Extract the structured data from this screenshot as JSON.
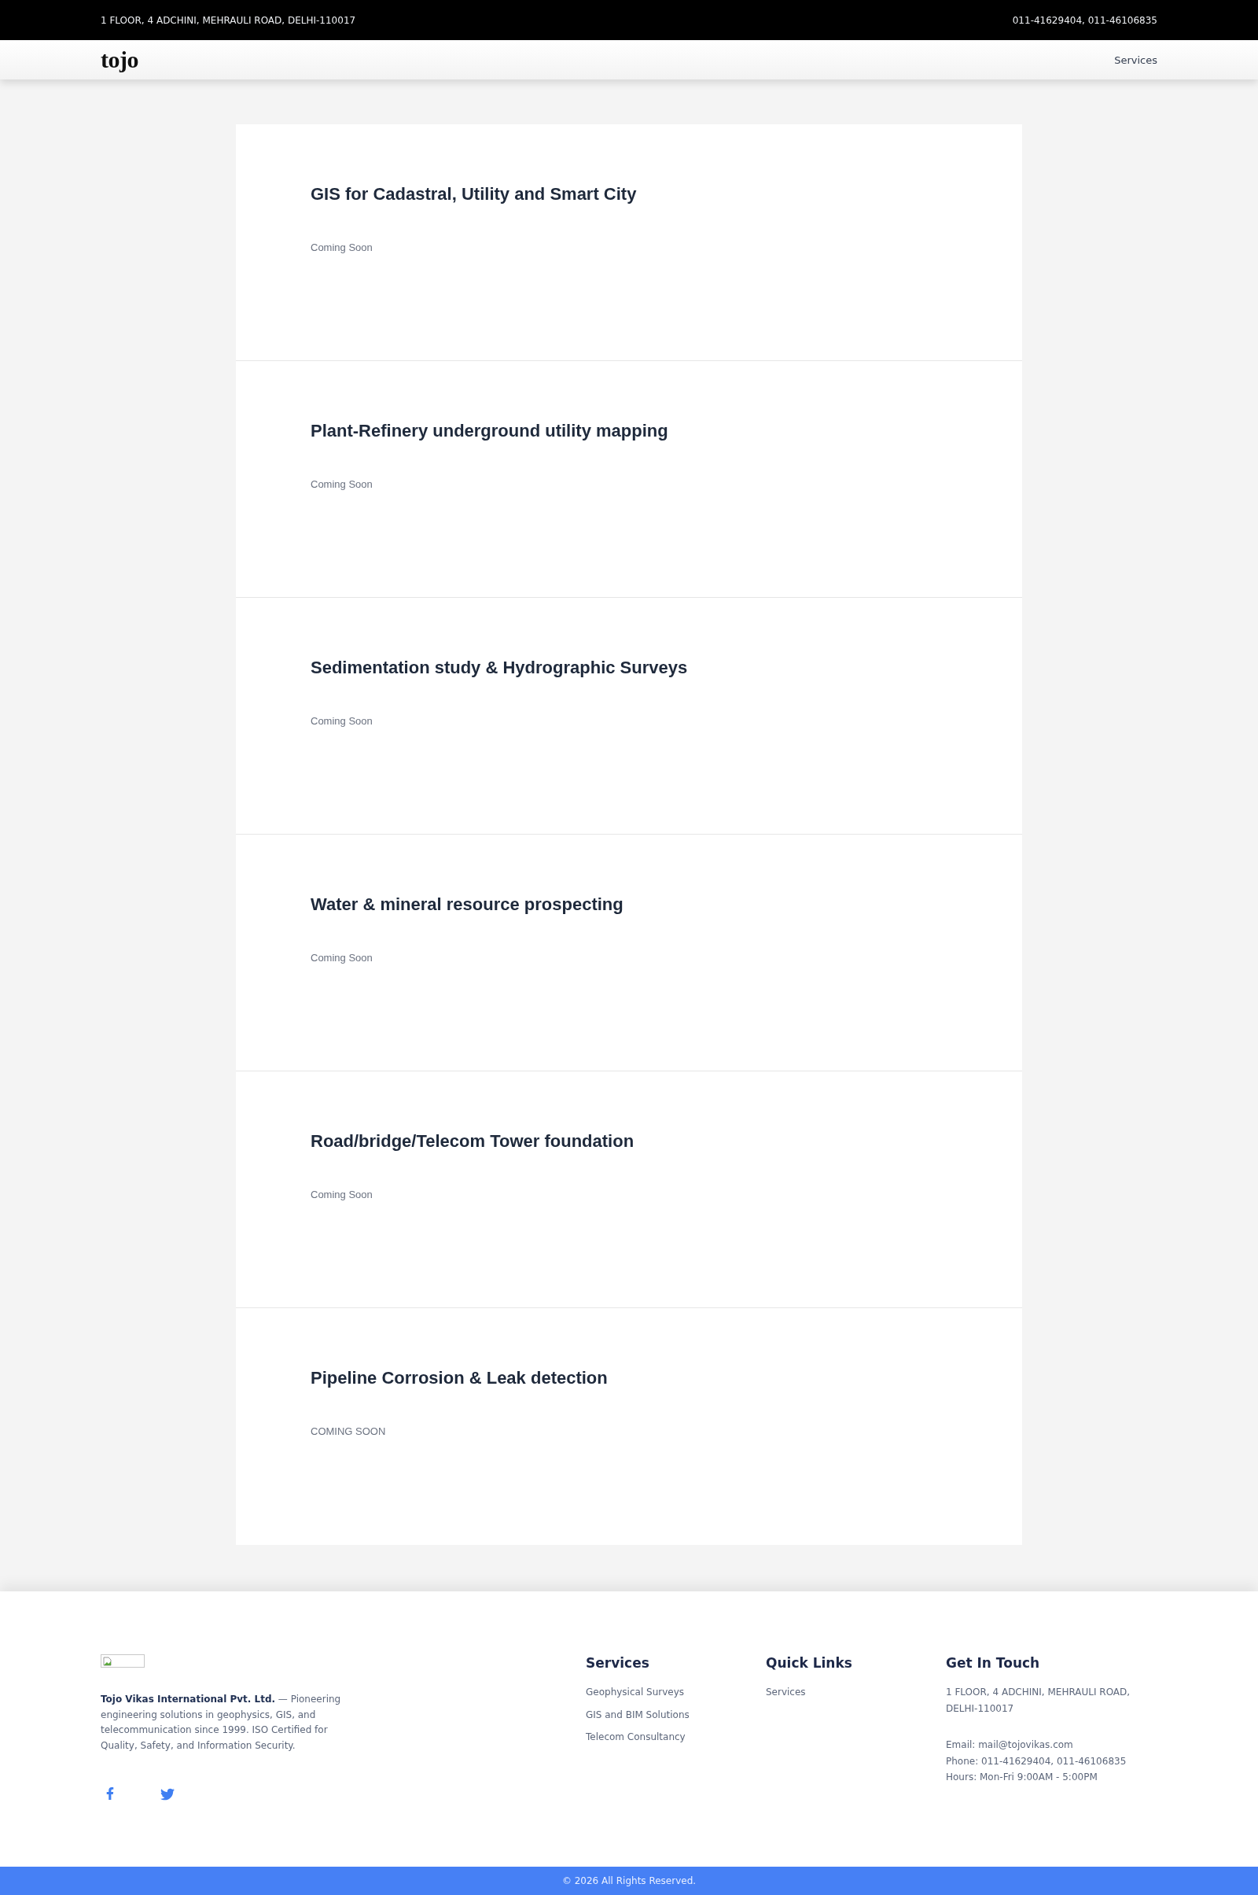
{
  "top_bar": {
    "address": "1 FLOOR, 4 ADCHINI, MEHRAULI ROAD, DELHI-110017",
    "phone": "011-41629404, 011-46106835"
  },
  "nav": {
    "logo": "tojo",
    "links": [
      {
        "label": "Services"
      }
    ]
  },
  "services": [
    {
      "title": "GIS for Cadastral, Utility and Smart City",
      "status": "Coming Soon"
    },
    {
      "title": "Plant-Refinery underground utility mapping",
      "status": "Coming Soon"
    },
    {
      "title": "Sedimentation study & Hydrographic Surveys",
      "status": "Coming Soon"
    },
    {
      "title": "Water & mineral resource prospecting",
      "status": "Coming Soon"
    },
    {
      "title": "Road/bridge/Telecom Tower foundation",
      "status": "Coming Soon"
    },
    {
      "title": "Pipeline Corrosion & Leak detection",
      "status": "COMING SOON"
    }
  ],
  "footer": {
    "about": "**Tojo Vikas International Pvt. Ltd.** — Pioneering engineering solutions in geophysics, GIS, and telecommunication since 1999. ISO Certified for Quality, Safety, and Information Security.",
    "social": [
      {
        "kind": "facebook"
      },
      {
        "kind": "twitter"
      }
    ],
    "columns": [
      {
        "heading": "Services",
        "links": [
          "Geophysical Surveys",
          "GIS and BIM Solutions",
          "Telecom Consultancy"
        ]
      },
      {
        "heading": "Quick Links",
        "links": [
          "Services"
        ]
      }
    ],
    "contact": {
      "heading": "Get In Touch",
      "address": "1 FLOOR, 4 ADCHINI, MEHRAULI ROAD, DELHI-110017",
      "lines": [
        "Email: mail@tojovikas.com",
        "Phone: 011-41629404, 011-46106835",
        "Hours: Mon-Fri 9:00AM - 5:00PM"
      ]
    }
  },
  "copyright": "© 2026 All Rights Reserved."
}
